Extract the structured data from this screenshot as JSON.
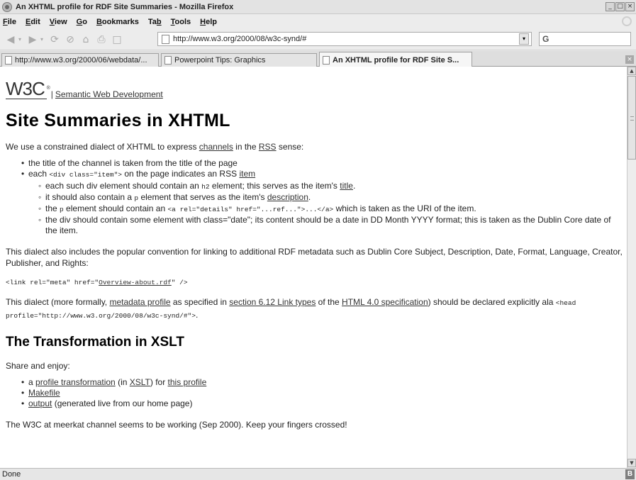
{
  "window": {
    "title": "An XHTML profile for RDF Site Summaries - Mozilla Firefox",
    "buttons": [
      "_",
      "□",
      "×"
    ]
  },
  "menu": {
    "items": [
      {
        "u": "F",
        "rest": "ile"
      },
      {
        "u": "E",
        "rest": "dit"
      },
      {
        "u": "V",
        "rest": "iew"
      },
      {
        "u": "G",
        "rest": "o"
      },
      {
        "u": "B",
        "rest": "ookmarks"
      },
      {
        "pre": "Ta",
        "u": "b",
        "rest": ""
      },
      {
        "u": "T",
        "rest": "ools"
      },
      {
        "u": "H",
        "rest": "elp"
      }
    ]
  },
  "nav": {
    "url": "http://www.w3.org/2000/08/w3c-synd/#",
    "search_glyph": "G"
  },
  "tabs": [
    {
      "label": "http://www.w3.org/2000/06/webdata/...",
      "active": false
    },
    {
      "label": "Powerpoint Tips: Graphics",
      "active": false
    },
    {
      "label": "An XHTML profile for RDF Site S...",
      "active": true
    }
  ],
  "page": {
    "logo": "W3C",
    "logo_mark": "®",
    "logo_sep": "|",
    "semweb_link": "Semantic Web Development",
    "h1": "Site Summaries in XHTML",
    "intro": {
      "t1": "We use a constrained dialect of XHTML to express ",
      "l1": "channels",
      "t2": " in the ",
      "l2": "RSS",
      "t3": " sense:"
    },
    "list": {
      "b1": "the title of the channel is taken from the title of the page",
      "b2": {
        "t1": "each ",
        "c1": "<div class=\"item\">",
        "t2": " on the page indicates an RSS ",
        "l1": "item"
      },
      "sub": {
        "s1": {
          "t1": "each such div element should contain an ",
          "c1": "h2",
          "t2": " element; this serves as the item's ",
          "l1": "title",
          "t3": "."
        },
        "s2": {
          "t1": "it should also contain a ",
          "c1": "p",
          "t2": " element that serves as the item's ",
          "l1": "description",
          "t3": "."
        },
        "s3": {
          "t1": "the ",
          "c1": "p",
          "t2": " element should contain an ",
          "c2": "<a rel=\"details\" href=\"...ref...\">...</a>",
          "t3": " which is taken as the URI of the item."
        },
        "s4": {
          "t1": "the div should contain some element with class=\"date\"; its content should be a date in DD Month YYYY format; this is taken as the Dublin Core date of the item."
        }
      }
    },
    "dialect_para": "This dialect also includes the popular convention for linking to additional RDF metadata such as Dublin Core Subject, Description, Date, Format, Language, Creator, Publisher, and Rights:",
    "code_line": {
      "pre": "<link rel=\"meta\" href=\"",
      "link": "Overview-about.rdf",
      "post": "\" />"
    },
    "formal_para": {
      "t1": "This dialect (more formally, ",
      "l1": "metadata profile",
      "t2": " as specified in ",
      "l2": "section 6.12 Link types",
      "t3": " of the ",
      "l3": "HTML 4.0 specification",
      "t4": ") should be declared explicitly ala ",
      "c1": "<head profile=\"http://www.w3.org/2000/08/w3c-synd/#\">",
      "t5": "."
    },
    "h2": "The Transformation in XSLT",
    "share": "Share and enjoy:",
    "list2": {
      "i1": {
        "t1": "a ",
        "l1": "profile transformation",
        "t2": " (in ",
        "l2": "XSLT",
        "t3": ") for ",
        "l3": "this profile"
      },
      "i2": {
        "l1": "Makefile"
      },
      "i3": {
        "l1": "output",
        "t1": " (generated live from our home page)"
      }
    },
    "last_para": "The W3C at meerkat channel seems to be working (Sep 2000). Keep your fingers crossed!"
  },
  "status": {
    "text": "Done",
    "badge": "B"
  }
}
